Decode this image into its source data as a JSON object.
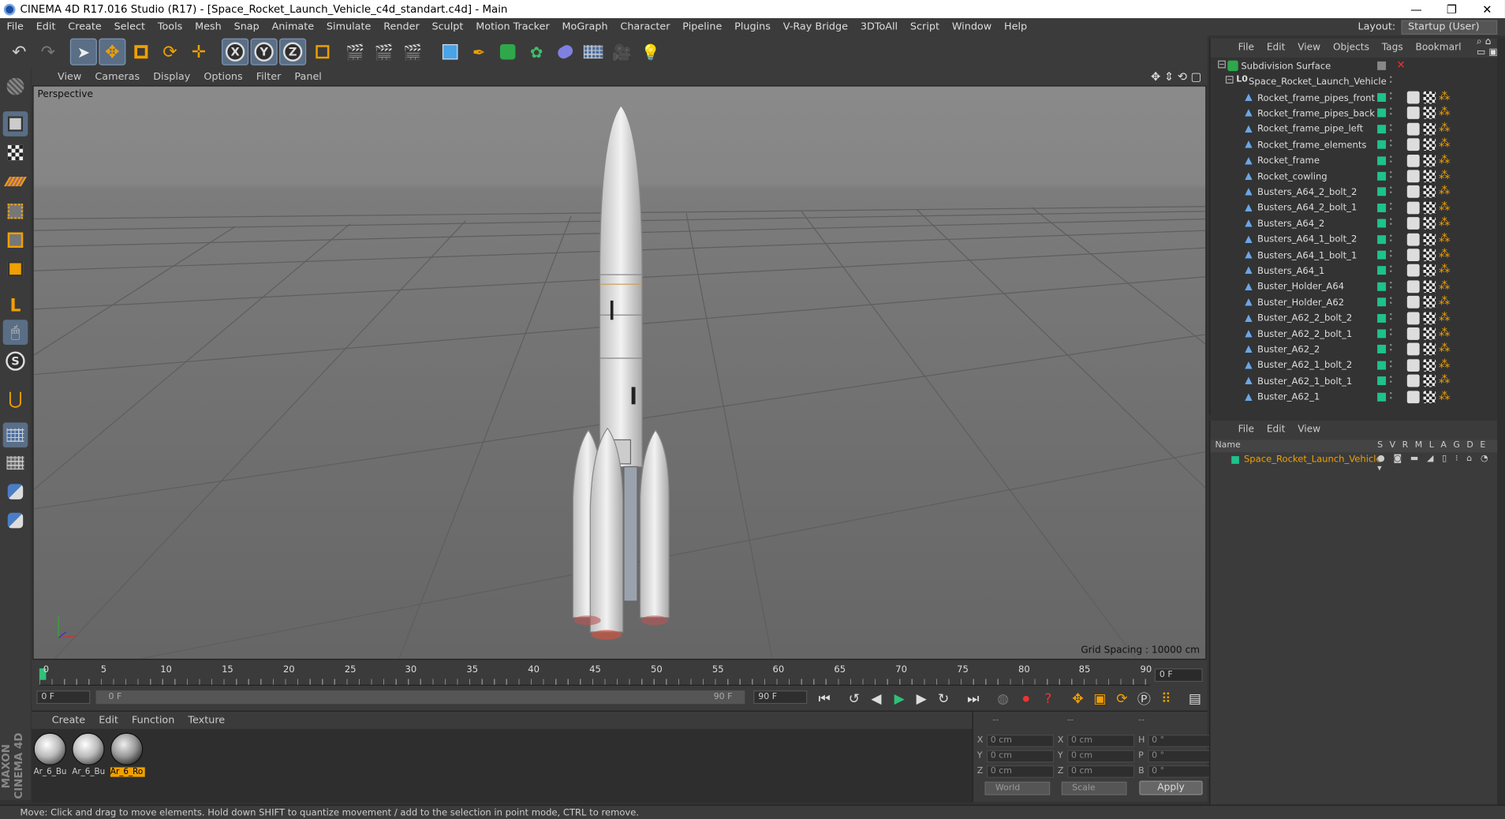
{
  "window": {
    "title": "CINEMA 4D R17.016 Studio (R17) - [Space_Rocket_Launch_Vehicle_c4d_standart.c4d] - Main",
    "min": "—",
    "max": "❐",
    "close": "✕"
  },
  "menubar": [
    "File",
    "Edit",
    "Create",
    "Select",
    "Tools",
    "Mesh",
    "Snap",
    "Animate",
    "Simulate",
    "Render",
    "Sculpt",
    "Motion Tracker",
    "MoGraph",
    "Character",
    "Pipeline",
    "Plugins",
    "V-Ray Bridge",
    "3DToAll",
    "Script",
    "Window",
    "Help"
  ],
  "layout": {
    "label": "Layout:",
    "value": "Startup (User)"
  },
  "viewport": {
    "menu": [
      "View",
      "Cameras",
      "Display",
      "Options",
      "Filter",
      "Panel"
    ],
    "label": "Perspective",
    "grid_spacing": "Grid Spacing : 10000 cm"
  },
  "timeline": {
    "ticks": [
      "0",
      "5",
      "10",
      "15",
      "20",
      "25",
      "30",
      "35",
      "40",
      "45",
      "50",
      "55",
      "60",
      "65",
      "70",
      "75",
      "80",
      "85",
      "90"
    ],
    "current_frame": "0 F"
  },
  "playbar": {
    "start": "0 F",
    "range_start": "0 F",
    "range_end": "90 F",
    "end": "90 F"
  },
  "materials": {
    "menu": [
      "Create",
      "Edit",
      "Function",
      "Texture"
    ],
    "items": [
      {
        "name": "Ar_6_Bu",
        "selected": false
      },
      {
        "name": "Ar_6_Bu",
        "selected": false
      },
      {
        "name": "Ar_6_Ro",
        "selected": true
      }
    ]
  },
  "coords": {
    "headers": [
      "--",
      "--",
      "--"
    ],
    "rows": [
      {
        "a": "X",
        "av": "0 cm",
        "b": "X",
        "bv": "0 cm",
        "c": "H",
        "cv": "0 °"
      },
      {
        "a": "Y",
        "av": "0 cm",
        "b": "Y",
        "bv": "0 cm",
        "c": "P",
        "cv": "0 °"
      },
      {
        "a": "Z",
        "av": "0 cm",
        "b": "Z",
        "bv": "0 cm",
        "c": "B",
        "cv": "0 °"
      }
    ],
    "world": "World",
    "scale": "Scale",
    "apply": "Apply"
  },
  "object_manager": {
    "menu": [
      "File",
      "Edit",
      "View",
      "Objects",
      "Tags",
      "Bookmarl"
    ],
    "root": "Subdivision Surface",
    "group": "Space_Rocket_Launch_Vehicle",
    "objects": [
      "Rocket_frame_pipes_front",
      "Rocket_frame_pipes_back",
      "Rocket_frame_pipe_left",
      "Rocket_frame_elements",
      "Rocket_frame",
      "Rocket_cowling",
      "Busters_A64_2_bolt_2",
      "Busters_A64_2_bolt_1",
      "Busters_A64_2",
      "Busters_A64_1_bolt_2",
      "Busters_A64_1_bolt_1",
      "Busters_A64_1",
      "Buster_Holder_A64",
      "Buster_Holder_A62",
      "Buster_A62_2_bolt_2",
      "Buster_A62_2_bolt_1",
      "Buster_A62_2",
      "Buster_A62_1_bolt_2",
      "Buster_A62_1_bolt_1",
      "Buster_A62_1"
    ]
  },
  "attribute_manager": {
    "menu": [
      "File",
      "Edit",
      "View"
    ],
    "header_name": "Name",
    "cols": [
      "S",
      "V",
      "R",
      "M",
      "L",
      "A",
      "G",
      "D",
      "E"
    ],
    "row": "Space_Rocket_Launch_Vehicle"
  },
  "status": "Move: Click and drag to move elements. Hold down SHIFT to quantize movement / add to the selection in point mode, CTRL to remove.",
  "logo": "MAXON CINEMA 4D"
}
